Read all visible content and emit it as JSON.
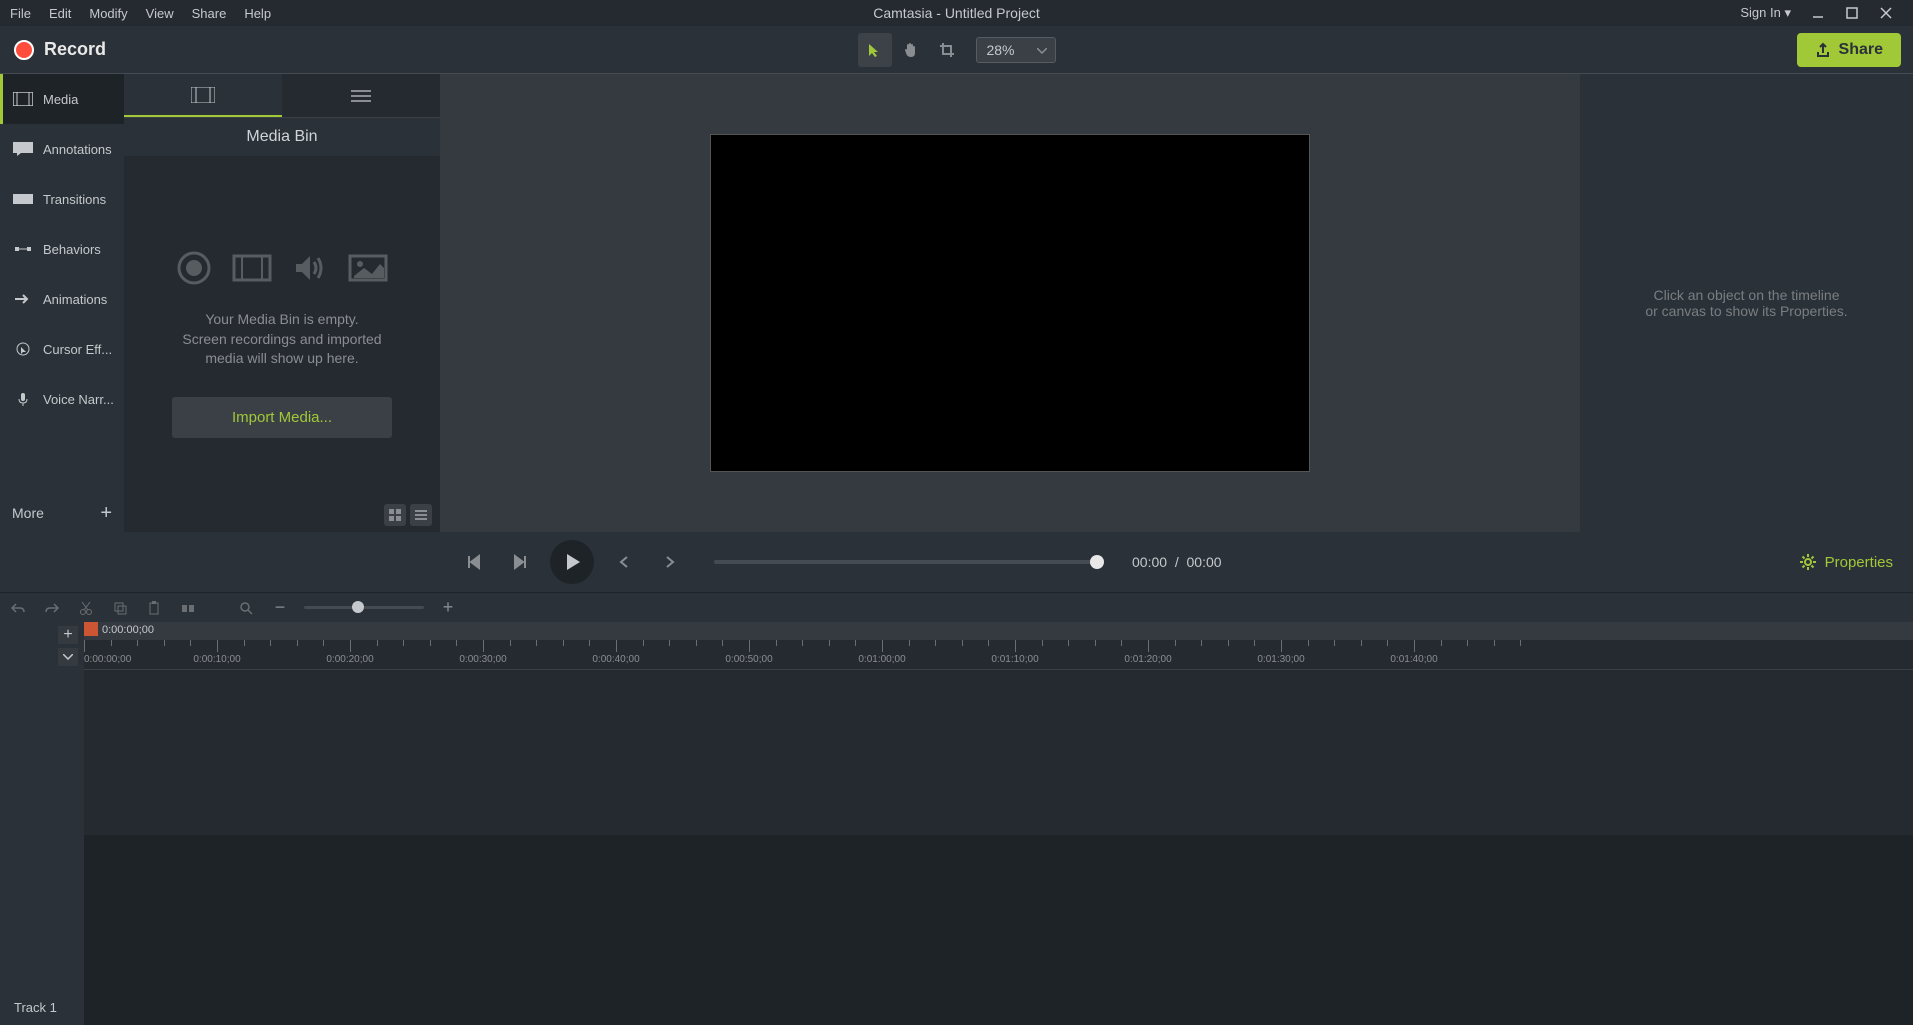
{
  "menubar": [
    "File",
    "Edit",
    "Modify",
    "View",
    "Share",
    "Help"
  ],
  "title": "Camtasia - Untitled Project",
  "signin": "Sign In ▾",
  "toolbar": {
    "record": "Record",
    "zoom": "28%",
    "share": "Share"
  },
  "sidebar": {
    "items": [
      {
        "label": "Media"
      },
      {
        "label": "Annotations"
      },
      {
        "label": "Transitions"
      },
      {
        "label": "Behaviors"
      },
      {
        "label": "Animations"
      },
      {
        "label": "Cursor Eff..."
      },
      {
        "label": "Voice Narr..."
      }
    ],
    "more": "More"
  },
  "media_panel": {
    "title": "Media Bin",
    "empty_line1": "Your Media Bin is empty.",
    "empty_line2": "Screen recordings and imported",
    "empty_line3": "media will show up here.",
    "import": "Import Media..."
  },
  "properties_panel": {
    "hint_line1": "Click an object on the timeline",
    "hint_line2": "or canvas to show its Properties."
  },
  "playback": {
    "current": "00:00",
    "sep": "/",
    "total": "00:00",
    "properties": "Properties"
  },
  "timeline": {
    "playhead_time": "0:00:00;00",
    "ticks": [
      "0:00:00;00",
      "0:00:10;00",
      "0:00:20;00",
      "0:00:30;00",
      "0:00:40;00",
      "0:00:50;00",
      "0:01:00;00",
      "0:01:10;00",
      "0:01:20;00",
      "0:01:30;00",
      "0:01:40;00"
    ],
    "track1": "Track 1"
  }
}
